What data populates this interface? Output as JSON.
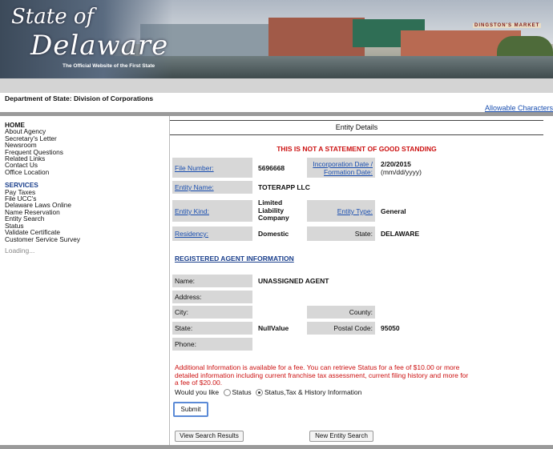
{
  "banner": {
    "logo_line1": "State of",
    "logo_line2": "Delaware",
    "tagline": "The Official Website of the First State",
    "sign_text": "DINGSTON'S MARKET"
  },
  "header": {
    "department": "Department of State: Division of Corporations",
    "allowable_link": "Allowable Characters"
  },
  "nav": {
    "home_heading": "HOME",
    "home_items": [
      "About Agency",
      "Secretary's Letter",
      "Newsroom",
      "Frequent Questions",
      "Related Links",
      "Contact Us",
      "Office Location"
    ],
    "services_heading": "SERVICES",
    "services_items": [
      "Pay Taxes",
      "File UCC's",
      "Delaware Laws Online",
      "Name Reservation",
      "Entity Search",
      "Status",
      "Validate Certificate",
      "Customer Service Survey"
    ],
    "loading": "Loading..."
  },
  "details": {
    "title": "Entity Details",
    "warning": "THIS IS NOT A STATEMENT OF GOOD STANDING",
    "file_number_label": "File Number:",
    "file_number": "5696668",
    "inc_date_label1": "Incorporation Date /",
    "inc_date_label2": "Formation Date:",
    "inc_date": "2/20/2015",
    "inc_date_fmt": "(mm/dd/yyyy)",
    "entity_name_label": "Entity Name:",
    "entity_name": "TOTERAPP LLC",
    "entity_kind_label": "Entity Kind:",
    "entity_kind_1": "Limited",
    "entity_kind_2": "Liability",
    "entity_kind_3": "Company",
    "entity_type_label": "Entity Type:",
    "entity_type": "General",
    "residency_label": "Residency:",
    "residency": "Domestic",
    "state_label": "State:",
    "state": "DELAWARE"
  },
  "agent": {
    "heading": "REGISTERED AGENT INFORMATION",
    "name_label": "Name:",
    "name": "UNASSIGNED AGENT",
    "address_label": "Address:",
    "city_label": "City:",
    "county_label": "County:",
    "state_label": "State:",
    "state": "NullValue",
    "postal_label": "Postal Code:",
    "postal": "95050",
    "phone_label": "Phone:"
  },
  "additional": {
    "info": "Additional Information is available for a fee. You can retrieve Status for a fee of $10.00 or more detailed information including current franchise tax assessment, current filing history and more for a fee of $20.00.",
    "would_you_like": "Would you like",
    "option_status": "Status",
    "option_full": "Status,Tax & History Information",
    "submit": "Submit",
    "view_results": "View Search Results",
    "new_search": "New Entity Search"
  }
}
